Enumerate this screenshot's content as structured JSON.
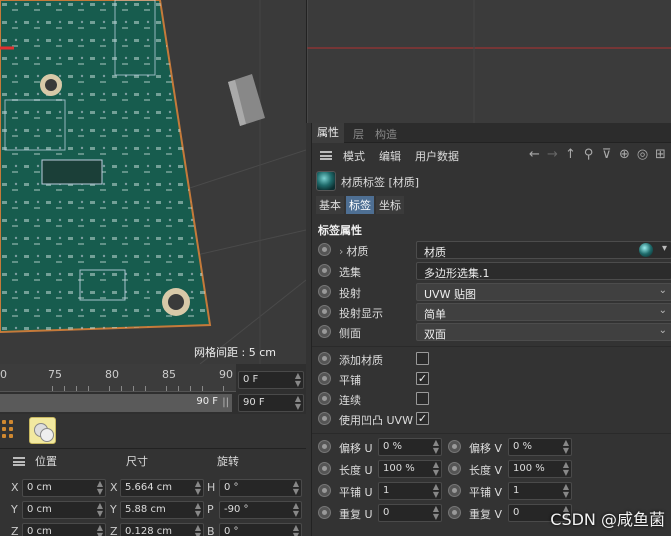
{
  "viewport": {
    "grid_readout": "网格间距 : 5 cm"
  },
  "timeline": {
    "ticks": [
      "75",
      "80",
      "85",
      "90"
    ],
    "current_frame": "0 F",
    "end_frame": "90 F",
    "range_end": "90 F",
    "range_handle": "||"
  },
  "coords": {
    "headers": {
      "position": "位置",
      "size": "尺寸",
      "rotation": "旋转"
    },
    "rows": [
      {
        "pos_axis": "X",
        "pos": "0 cm",
        "size_axis": "X",
        "size": "5.664 cm",
        "rot_axis": "H",
        "rot": "0 °"
      },
      {
        "pos_axis": "Y",
        "pos": "0 cm",
        "size_axis": "Y",
        "size": "5.88 cm",
        "rot_axis": "P",
        "rot": "-90 °"
      },
      {
        "pos_axis": "Z",
        "pos": "0 cm",
        "size_axis": "Z",
        "size": "0.128 cm",
        "rot_axis": "B",
        "rot": "0 °"
      }
    ]
  },
  "attributes": {
    "tabs": [
      "属性",
      "层",
      "构造"
    ],
    "menu": [
      "模式",
      "编辑",
      "用户数据"
    ],
    "object_title": "材质标签 [材质]",
    "subtabs": [
      "基本",
      "标签",
      "坐标"
    ],
    "section": "标签属性",
    "props": [
      {
        "label": "材质",
        "value": "材质",
        "arrow": "›"
      },
      {
        "label": "选集",
        "value": "多边形选集.1"
      },
      {
        "label": "投射",
        "value": "UVW 贴图"
      },
      {
        "label": "投射显示",
        "value": "简单"
      },
      {
        "label": "侧面",
        "value": "双面"
      }
    ],
    "checks": [
      {
        "label": "添加材质",
        "checked": ""
      },
      {
        "label": "平铺",
        "checked": "✓"
      },
      {
        "label": "连续",
        "checked": ""
      },
      {
        "label": "使用凹凸 UVW",
        "checked": "✓"
      }
    ],
    "uv": [
      {
        "left_label": "偏移 U",
        "left_value": "0 %",
        "right_label": "偏移 V",
        "right_value": "0 %"
      },
      {
        "left_label": "长度 U",
        "left_value": "100 %",
        "right_label": "长度 V",
        "right_value": "100 %"
      },
      {
        "left_label": "平铺 U",
        "left_value": "1",
        "right_label": "平铺 V",
        "right_value": "1"
      },
      {
        "left_label": "重复 U",
        "left_value": "0",
        "right_label": "重复 V",
        "right_value": "0"
      }
    ]
  },
  "watermark": "CSDN @咸鱼菌"
}
